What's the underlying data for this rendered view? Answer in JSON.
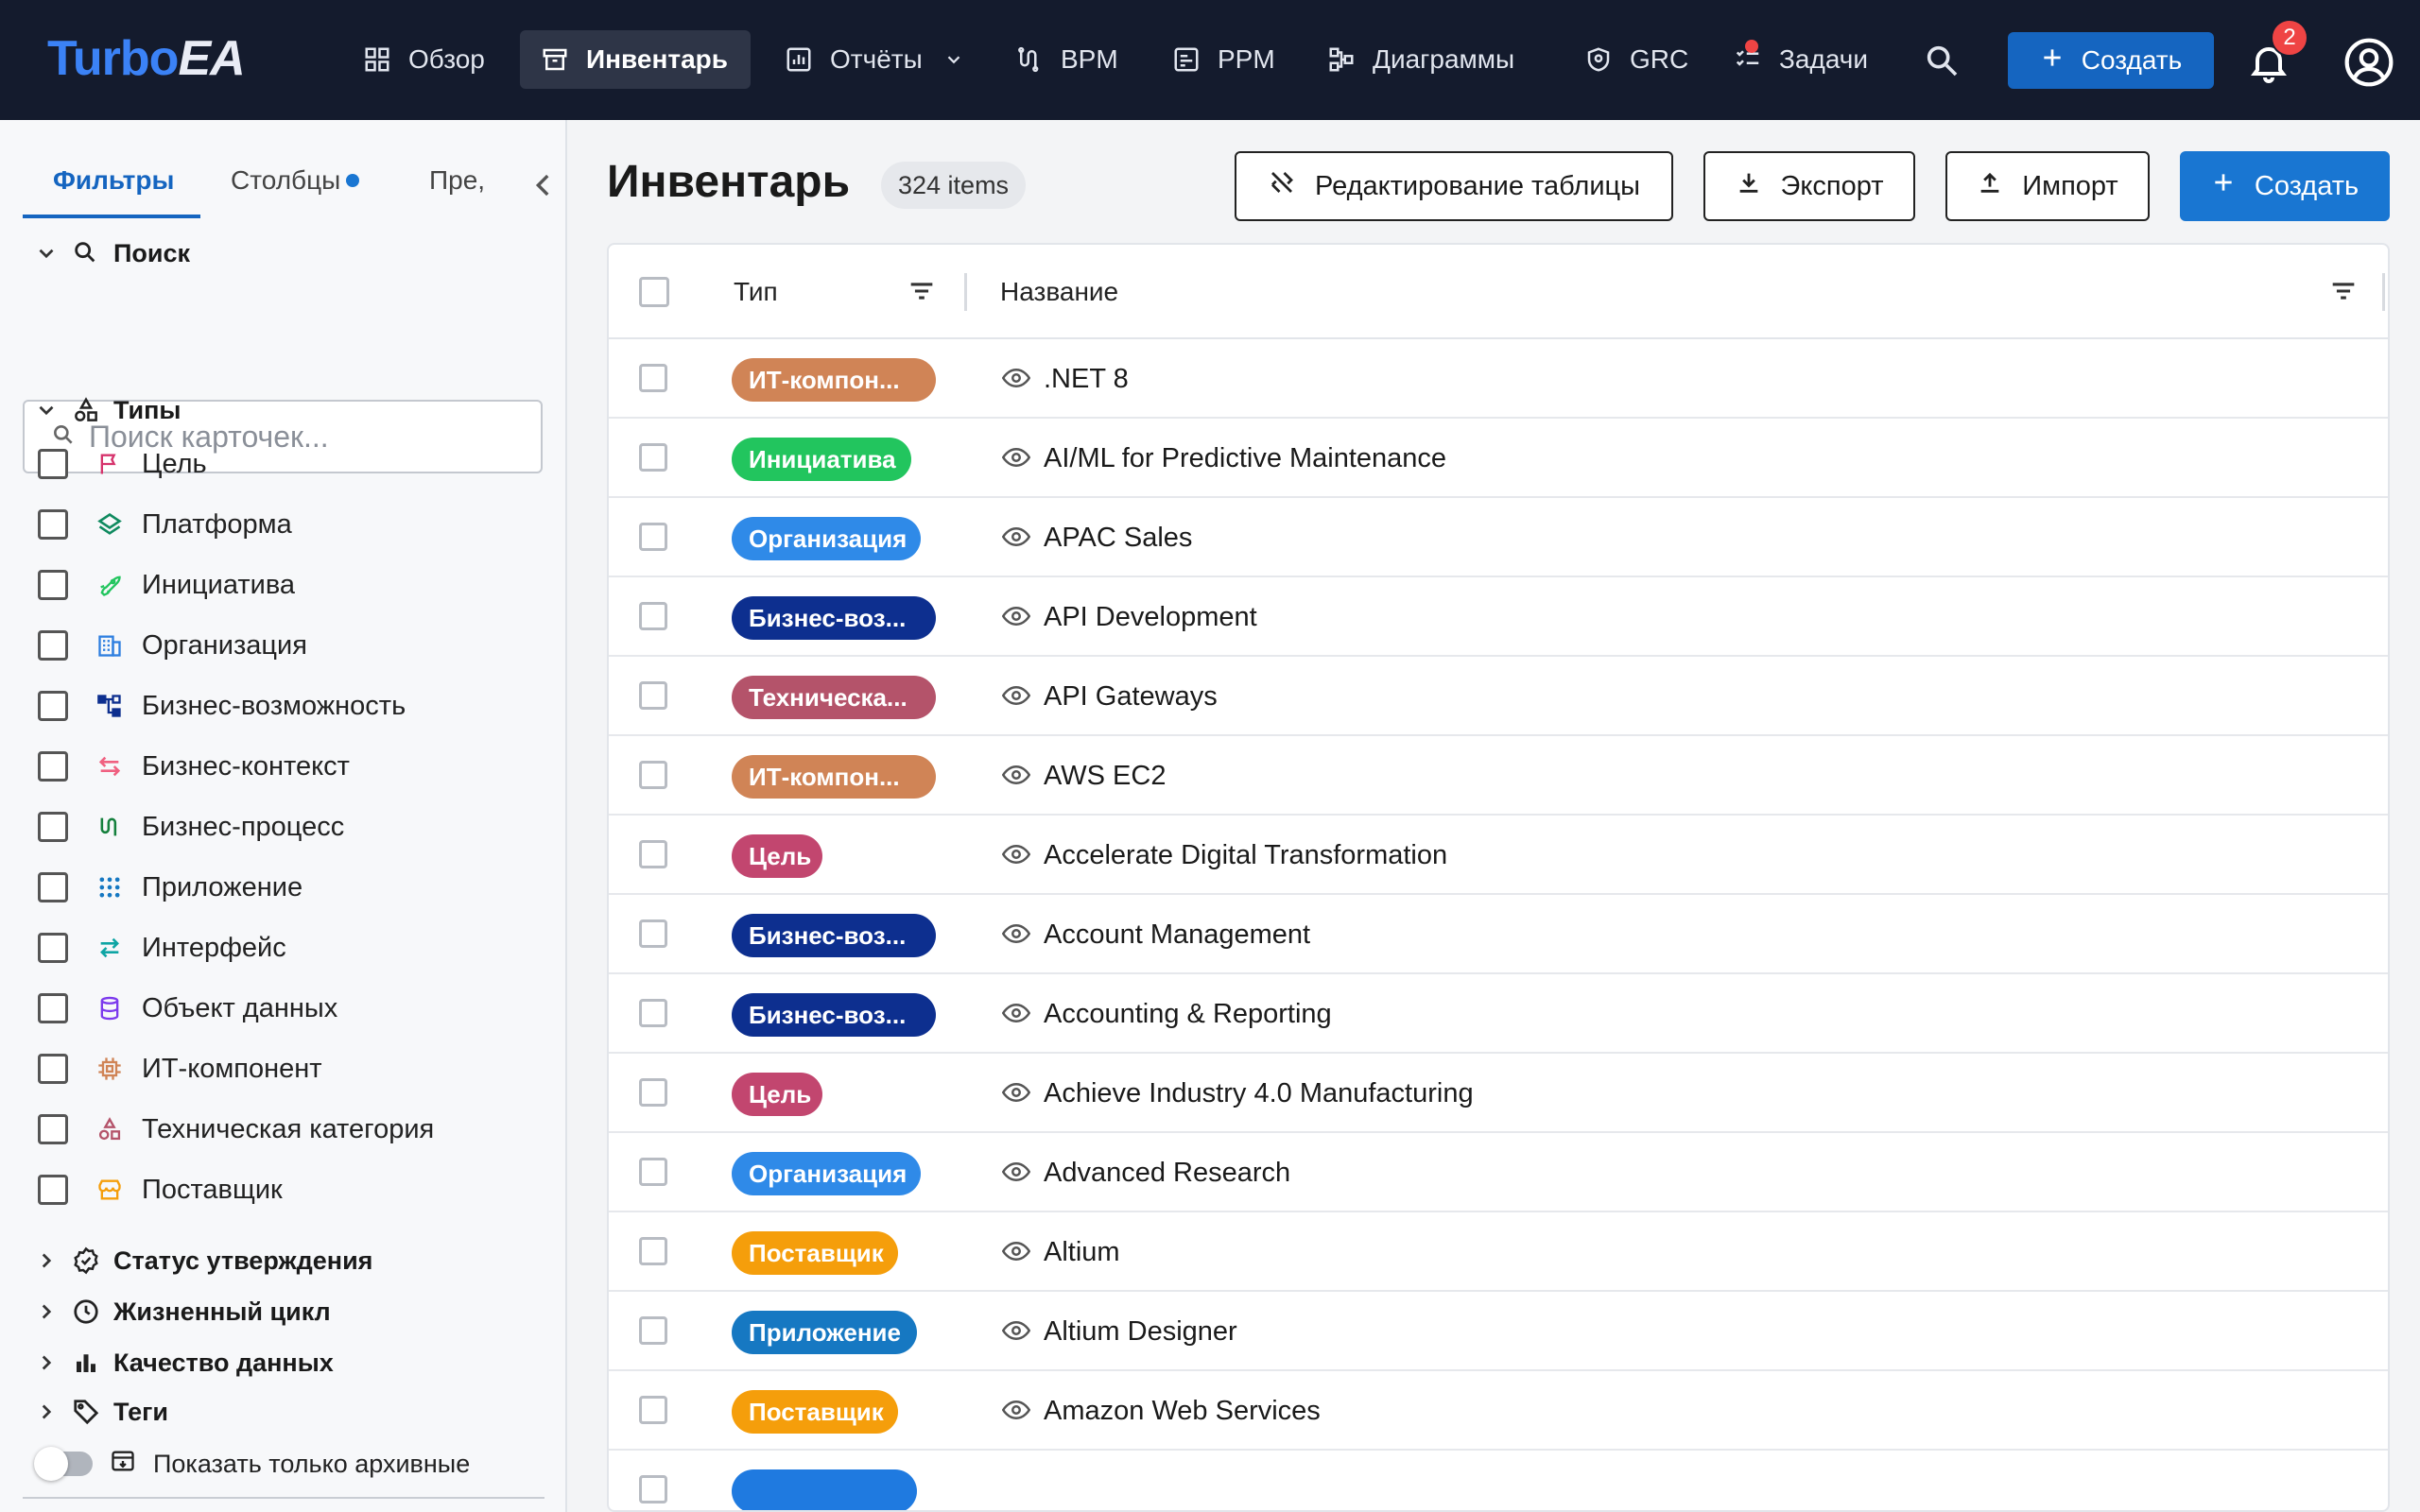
{
  "topbar": {
    "logo_left": "Turbo",
    "logo_right": "EA",
    "nav": [
      {
        "label": "Обзор",
        "icon": "dashboard-icon"
      },
      {
        "label": "Инвентарь",
        "icon": "inventory-icon"
      },
      {
        "label": "Отчёты",
        "icon": "reports-icon"
      },
      {
        "label": "BPM",
        "icon": "bpm-icon"
      },
      {
        "label": "PPM",
        "icon": "ppm-icon"
      },
      {
        "label": "Диаграммы",
        "icon": "diagrams-icon"
      },
      {
        "label": "GRC",
        "icon": "shield-icon"
      },
      {
        "label": "Задачи",
        "icon": "tasks-icon"
      }
    ],
    "active_nav": "Инвентарь",
    "create_label": "Создать",
    "notifications_count": "2"
  },
  "sidebar": {
    "tabs": {
      "filters": "Фильтры",
      "columns": "Столбцы",
      "presets": "Пре,"
    },
    "search_title": "Поиск",
    "search_placeholder": "Поиск карточек...",
    "types_title": "Типы",
    "types": [
      {
        "label": "Цель",
        "icon": "flag-icon",
        "color": "#d6336c"
      },
      {
        "label": "Платформа",
        "icon": "layers-icon",
        "color": "#0f8a5f"
      },
      {
        "label": "Инициатива",
        "icon": "rocket-icon",
        "color": "#22c55e"
      },
      {
        "label": "Организация",
        "icon": "building-icon",
        "color": "#2f7fe0"
      },
      {
        "label": "Бизнес-возможность",
        "icon": "hierarchy-icon",
        "color": "#0d2f8f"
      },
      {
        "label": "Бизнес-контекст",
        "icon": "swap-icon",
        "color": "#f06080"
      },
      {
        "label": "Бизнес-процесс",
        "icon": "process-icon",
        "color": "#15803d"
      },
      {
        "label": "Приложение",
        "icon": "apps-icon",
        "color": "#1678c2"
      },
      {
        "label": "Интерфейс",
        "icon": "arrows-icon",
        "color": "#0ea5a4"
      },
      {
        "label": "Объект данных",
        "icon": "database-icon",
        "color": "#7c3aed"
      },
      {
        "label": "ИТ-компонент",
        "icon": "chip-icon",
        "color": "#d08456"
      },
      {
        "label": "Техническая категория",
        "icon": "category-icon",
        "color": "#b4536a"
      },
      {
        "label": "Поставщик",
        "icon": "store-icon",
        "color": "#f59e0b"
      }
    ],
    "sections": [
      {
        "label": "Статус утверждения",
        "icon": "approval-icon"
      },
      {
        "label": "Жизненный цикл",
        "icon": "clock-icon"
      },
      {
        "label": "Качество данных",
        "icon": "bar-chart-icon"
      },
      {
        "label": "Теги",
        "icon": "tag-icon"
      }
    ],
    "archive_label": "Показать только архивные"
  },
  "main": {
    "title": "Инвентарь",
    "count": "324 items",
    "buttons": {
      "edit": "Редактирование таблицы",
      "export": "Экспорт",
      "import": "Импорт",
      "create": "Создать"
    },
    "columns": {
      "type": "Тип",
      "name": "Название"
    },
    "rows": [
      {
        "type": "ИТ-компон...",
        "color": "#d08456",
        "name": ".NET 8"
      },
      {
        "type": "Инициатива",
        "color": "#22c55e",
        "name": "AI/ML for Predictive Maintenance"
      },
      {
        "type": "Организация",
        "color": "#2f8ae8",
        "name": "APAC Sales"
      },
      {
        "type": "Бизнес-воз...",
        "color": "#0d2f8f",
        "name": "API Development"
      },
      {
        "type": "Техническа...",
        "color": "#b4536a",
        "name": "API Gateways"
      },
      {
        "type": "ИТ-компон...",
        "color": "#d08456",
        "name": "AWS EC2"
      },
      {
        "type": "Цель",
        "color": "#c2466f",
        "name": "Accelerate Digital Transformation"
      },
      {
        "type": "Бизнес-воз...",
        "color": "#0d2f8f",
        "name": "Account Management"
      },
      {
        "type": "Бизнес-воз...",
        "color": "#0d2f8f",
        "name": "Accounting & Reporting"
      },
      {
        "type": "Цель",
        "color": "#c2466f",
        "name": "Achieve Industry 4.0 Manufacturing"
      },
      {
        "type": "Организация",
        "color": "#2f8ae8",
        "name": "Advanced Research"
      },
      {
        "type": "Поставщик",
        "color": "#f59e0b",
        "name": "Altium"
      },
      {
        "type": "Приложение",
        "color": "#1678c2",
        "name": "Altium Designer"
      },
      {
        "type": "Поставщик",
        "color": "#f59e0b",
        "name": "Amazon Web Services"
      }
    ],
    "partial_row_color": "#1f7ae0"
  }
}
